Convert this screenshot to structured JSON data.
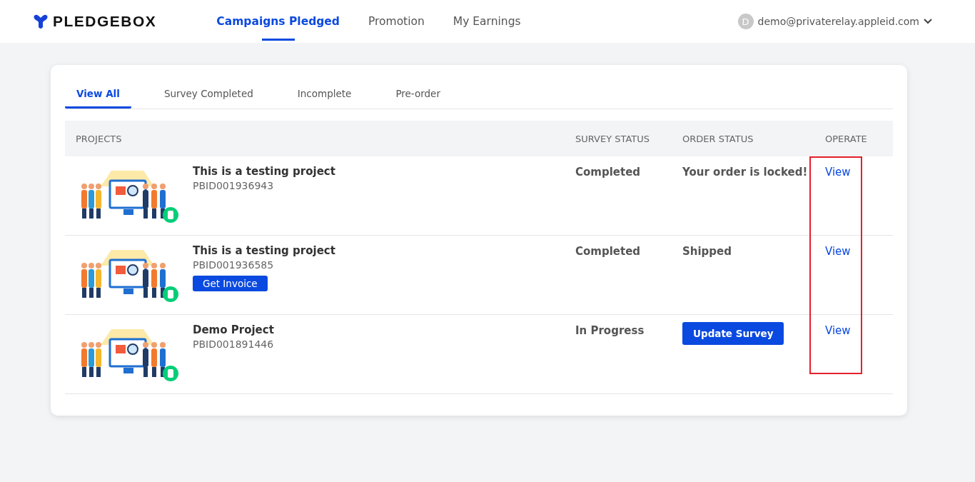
{
  "header": {
    "logo": "PLEDGEBOX",
    "nav": [
      {
        "label": "Campaigns Pledged",
        "selected": true
      },
      {
        "label": "Promotion",
        "selected": false
      },
      {
        "label": "My Earnings",
        "selected": false
      }
    ],
    "user": {
      "initial": "D",
      "email": "demo@privaterelay.appleid.com"
    }
  },
  "tabs": [
    {
      "label": "View All",
      "selected": true
    },
    {
      "label": "Survey Completed",
      "selected": false
    },
    {
      "label": "Incomplete",
      "selected": false
    },
    {
      "label": "Pre-order",
      "selected": false
    }
  ],
  "table": {
    "columns": [
      {
        "label": "PROJECTS",
        "highlighted": false
      },
      {
        "label": "SURVEY STATUS",
        "highlighted": false
      },
      {
        "label": "ORDER STATUS",
        "highlighted": false
      },
      {
        "label": "OPERATE",
        "highlighted": true
      }
    ],
    "rows": [
      {
        "title": "This is a testing project",
        "id": "PBID001936943",
        "button": null,
        "survey_status": "Completed",
        "order_status": {
          "kind": "text",
          "label": "Your order is locked!"
        },
        "operate": "View"
      },
      {
        "title": "This is a testing project",
        "id": "PBID001936585",
        "button": "Get Invoice",
        "survey_status": "Completed",
        "order_status": {
          "kind": "text",
          "label": "Shipped"
        },
        "operate": "View"
      },
      {
        "title": "Demo Project",
        "id": "PBID001891446",
        "button": null,
        "survey_status": "In Progress",
        "order_status": {
          "kind": "button",
          "label": "Update Survey"
        },
        "operate": "View"
      }
    ]
  }
}
